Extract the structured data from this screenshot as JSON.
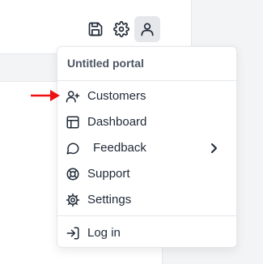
{
  "toolbar": {
    "icons": [
      "save-icon",
      "gear-icon",
      "user-icon"
    ]
  },
  "menu": {
    "title": "Untitled portal",
    "items": [
      {
        "label": "Customers",
        "icon": "user-plus-icon"
      },
      {
        "label": "Dashboard",
        "icon": "layout-icon"
      },
      {
        "label": "Feedback",
        "icon": "message-circle-icon",
        "submenu": true
      },
      {
        "label": "Support",
        "icon": "lifebuoy-icon"
      },
      {
        "label": "Settings",
        "icon": "gear-icon"
      },
      {
        "label": "Log in",
        "icon": "login-icon"
      }
    ]
  },
  "colors": {
    "accent_arrow": "#ee1111",
    "menu_border": "#e5e7eb",
    "active_icon_bg": "#e5e7eb"
  }
}
